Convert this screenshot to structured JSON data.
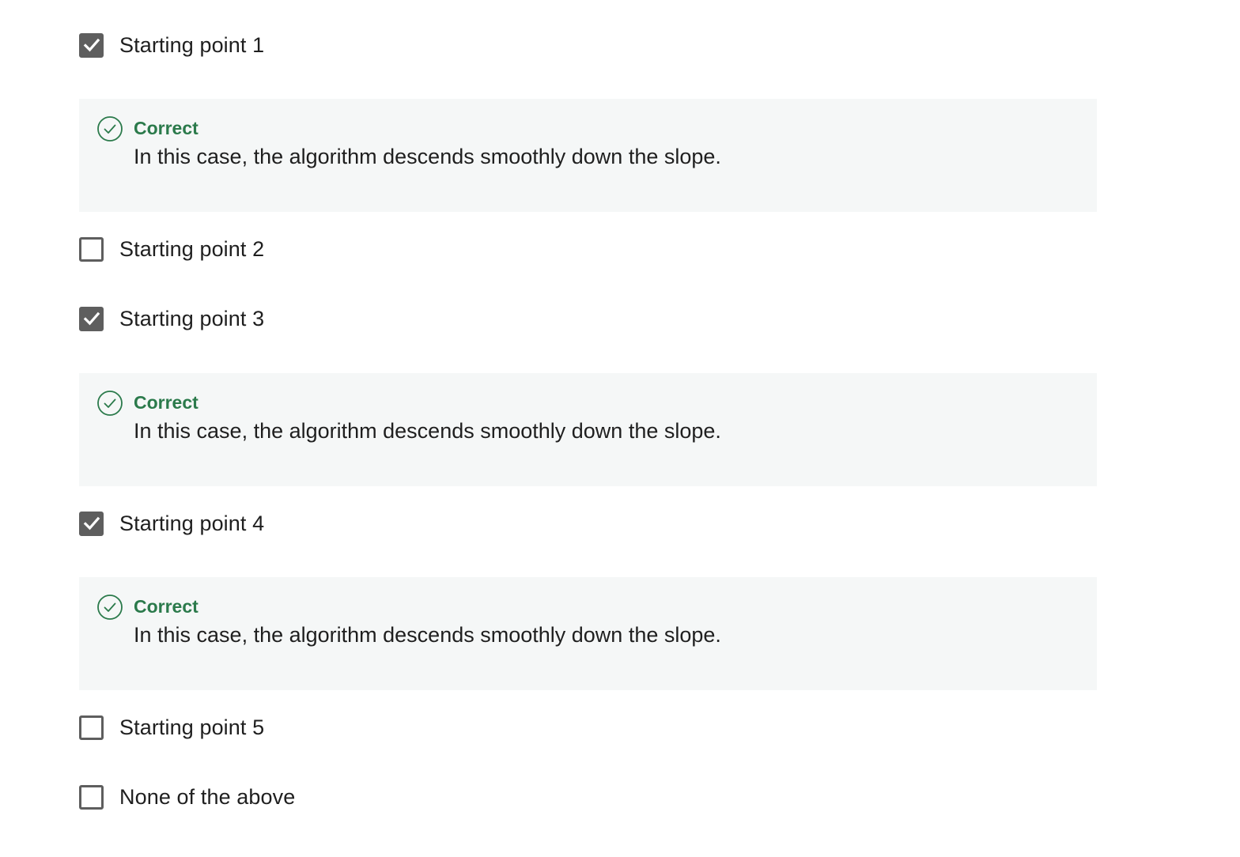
{
  "options": [
    {
      "label": "Starting point 1",
      "checked": true
    },
    {
      "label": "Starting point 2",
      "checked": false
    },
    {
      "label": "Starting point 3",
      "checked": true
    },
    {
      "label": "Starting point 4",
      "checked": true
    },
    {
      "label": "Starting point 5",
      "checked": false
    },
    {
      "label": "None of the above",
      "checked": false
    }
  ],
  "feedback": [
    {
      "status": "Correct",
      "text": "In this case, the algorithm descends smoothly down the slope.",
      "icon": "check-circle-icon"
    },
    {
      "status": "Correct",
      "text": "In this case, the algorithm descends smoothly down the slope.",
      "icon": "check-circle-icon"
    },
    {
      "status": "Correct",
      "text": "In this case, the algorithm descends smoothly down the slope.",
      "icon": "check-circle-icon"
    }
  ],
  "colors": {
    "checkbox": "#5e5e5e",
    "correct": "#2b7a4b",
    "feedback_bg": "#f5f7f7"
  }
}
